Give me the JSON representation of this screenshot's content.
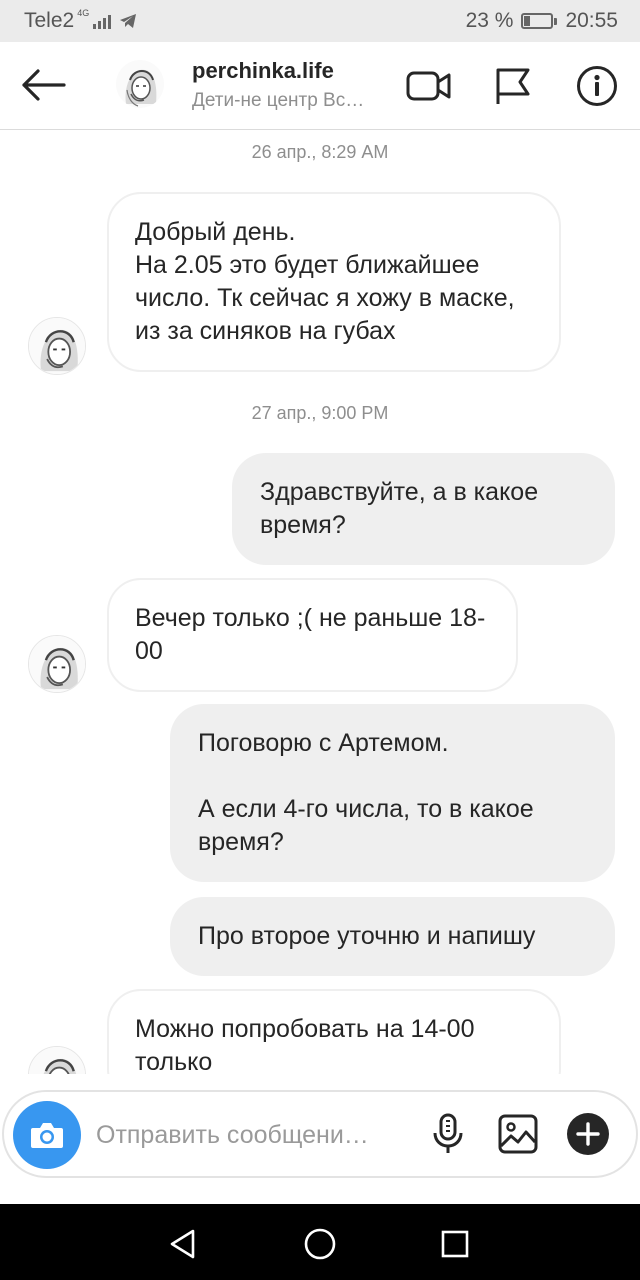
{
  "status_bar": {
    "carrier": "Tele2",
    "network": "4G",
    "battery_percent": "23 %",
    "battery_level": 0.23,
    "time": "20:55"
  },
  "header": {
    "back_icon": "arrow-left-icon",
    "name": "perchinka.life",
    "subtitle": "Дети-не центр Вс…",
    "icons": [
      "video-camera-icon",
      "flag-icon",
      "info-icon"
    ]
  },
  "thread": {
    "items": [
      {
        "type": "timestamp",
        "text": "26 апр., 8:29 AM"
      },
      {
        "type": "incoming",
        "text": "Добрый день.\nНа 2.05 это будет ближайшее число. Тк сейчас я хожу в маске, из за синяков на губах"
      },
      {
        "type": "timestamp",
        "text": "27 апр., 9:00 PM"
      },
      {
        "type": "outgoing",
        "text": "Здравствуйте, а в какое время?"
      },
      {
        "type": "incoming",
        "text": "Вечер только ;( не раньше 18-00"
      },
      {
        "type": "outgoing",
        "text": "Поговорю с Артемом.\n\nА если 4-го числа, то в какое время?"
      },
      {
        "type": "outgoing",
        "text": "Про второе уточню и напишу"
      },
      {
        "type": "incoming",
        "text": "Можно попробовать на 14-00 только"
      }
    ]
  },
  "composer": {
    "placeholder": "Отправить сообщени…",
    "icons": [
      "camera-icon",
      "microphone-icon",
      "gallery-icon",
      "plus-icon"
    ]
  },
  "nav_bar": {
    "icons": [
      "back-triangle-icon",
      "home-circle-icon",
      "recents-square-icon"
    ]
  },
  "colors": {
    "accent": "#3897f0",
    "outgoing_bubble": "#efefef",
    "text": "#262626",
    "muted": "#8e8e8e"
  }
}
